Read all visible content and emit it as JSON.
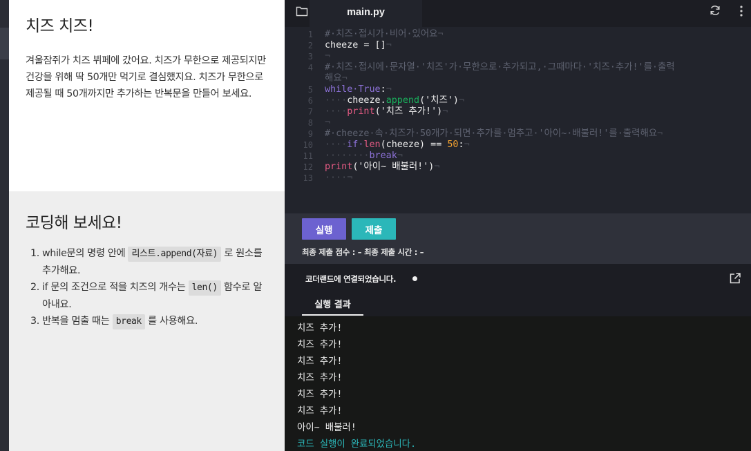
{
  "instructions": {
    "title": "치즈 치즈!",
    "body": "겨울잠쥐가 치즈 뷔페에 갔어요. 치즈가 무한으로 제공되지만 건강을 위해 딱 50개만 먹기로 결심했지요. 치즈가 무한으로 제공될 때 50개까지만 추가하는 반복문을 만들어 보세요."
  },
  "task": {
    "title": "코딩해 보세요!",
    "items": [
      {
        "before": "while문의 명령 안에 ",
        "code": "리스트.append(자료)",
        "after": " 로 원소를 추가해요."
      },
      {
        "before": "if 문의 조건으로 적을 치즈의 개수는 ",
        "code": "len()",
        "after": " 함수로 알아내요."
      },
      {
        "before": "반복을 멈출 때는 ",
        "code": "break",
        "after": " 를 사용해요."
      }
    ]
  },
  "editor": {
    "filename": "main.py",
    "line_numbers": [
      "1",
      "2",
      "3",
      "4",
      "",
      "5",
      "6",
      "7",
      "8",
      "9",
      "10",
      "11",
      "12",
      "13"
    ],
    "lines": [
      [
        [
          "c-comment",
          "#·치즈·접시가·비어·있어요"
        ],
        [
          "c-ws",
          "¬"
        ]
      ],
      [
        [
          "src",
          "cheeze = []"
        ],
        [
          "c-ws",
          "¬"
        ]
      ],
      [
        [
          "c-ws",
          "¬"
        ]
      ],
      [
        [
          "c-comment",
          "#·치즈·접시에·문자열·'치즈'가·무한으로·추가되고,·그때마다·'치즈·추가!'를·출력"
        ]
      ],
      [
        [
          "c-comment",
          "해요"
        ],
        [
          "c-ws",
          "¬"
        ]
      ],
      [
        [
          "c-kw",
          "while·True"
        ],
        [
          "src",
          ":"
        ],
        [
          "c-ws",
          "¬"
        ]
      ],
      [
        [
          "c-ws",
          "····"
        ],
        [
          "src",
          "cheeze."
        ],
        [
          "c-fn",
          "append"
        ],
        [
          "src",
          "('치즈')"
        ],
        [
          "c-ws",
          "¬"
        ]
      ],
      [
        [
          "c-ws",
          "····"
        ],
        [
          "c-pr",
          "print"
        ],
        [
          "src",
          "('치즈 추가!')"
        ],
        [
          "c-ws",
          "¬"
        ]
      ],
      [
        [
          "c-ws",
          "¬"
        ]
      ],
      [
        [
          "c-comment",
          "#·cheeze·속·치즈가·50개가·되면·추가를·멈추고·'아이~·배불러!'를·출력해요"
        ],
        [
          "c-ws",
          "¬"
        ]
      ],
      [
        [
          "c-ws",
          "····"
        ],
        [
          "c-kw",
          "if·"
        ],
        [
          "c-pr",
          "len"
        ],
        [
          "src",
          "(cheeze) == "
        ],
        [
          "c-num",
          "50"
        ],
        [
          "src",
          ":"
        ],
        [
          "c-ws",
          "¬"
        ]
      ],
      [
        [
          "c-ws",
          "········"
        ],
        [
          "c-kw",
          "break"
        ],
        [
          "c-ws",
          "¬"
        ]
      ],
      [
        [
          "c-pr",
          "print"
        ],
        [
          "src",
          "('아이~ 배불러!')"
        ],
        [
          "c-ws",
          "¬"
        ]
      ],
      [
        [
          "c-ws",
          "····¬"
        ]
      ]
    ]
  },
  "actions": {
    "run_label": "실행",
    "submit_label": "제출",
    "score_text": "최종 제출 점수 : –  최종 제출 시간 : –"
  },
  "result": {
    "connection_text": "코더랜드에 연결되었습니다.",
    "tab_label": "실행 결과",
    "output": [
      "치즈 추가!",
      "치즈 추가!",
      "치즈 추가!",
      "치즈 추가!",
      "치즈 추가!",
      "치즈 추가!",
      "아이~ 배불러!"
    ],
    "done_text": "코드 실행이 완료되었습니다."
  }
}
